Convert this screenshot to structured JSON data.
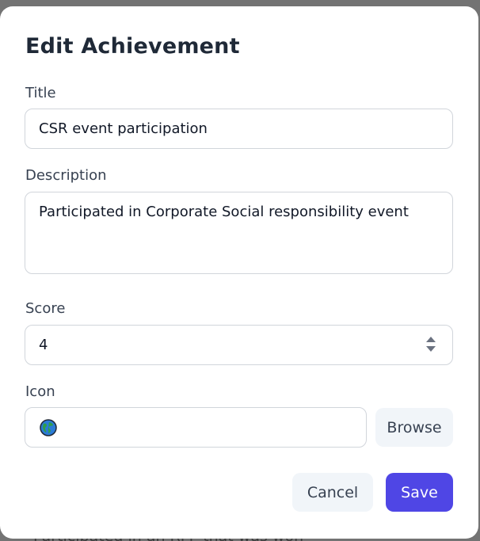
{
  "background": {
    "partial_text": "Participated in an RFP that was won"
  },
  "dialog": {
    "title": "Edit Achievement",
    "title_field": {
      "label": "Title",
      "value": "CSR event participation"
    },
    "description_field": {
      "label": "Description",
      "value": "Participated in Corporate Social responsibility event"
    },
    "score_field": {
      "label": "Score",
      "value": "4"
    },
    "icon_field": {
      "label": "Icon",
      "icon": "globe-icon",
      "browse_label": "Browse"
    },
    "cancel_label": "Cancel",
    "save_label": "Save"
  },
  "colors": {
    "primary": "#4f46e5",
    "secondary_button_bg": "#f1f5f9",
    "overlay": "#737373"
  }
}
